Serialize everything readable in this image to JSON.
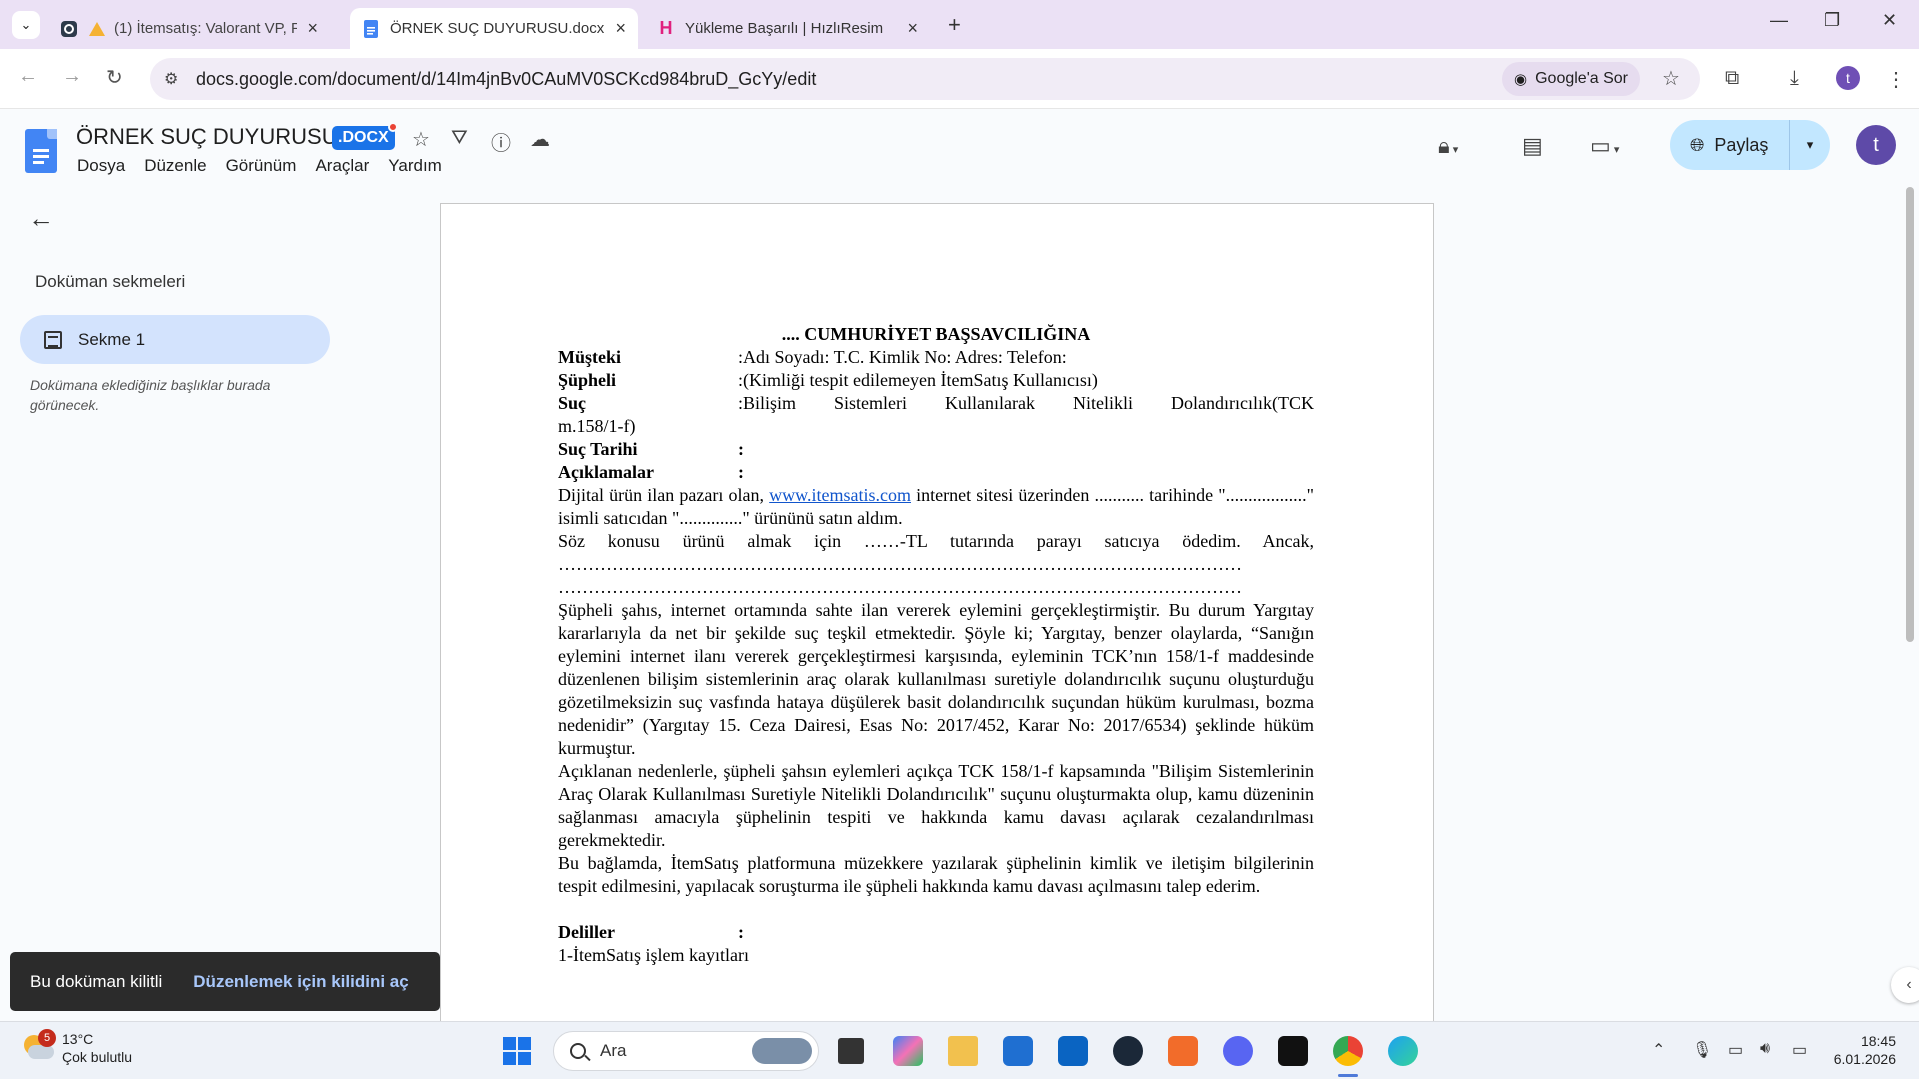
{
  "browser": {
    "tabs": [
      {
        "title": "(1) İtemsatış: Valorant VP, P",
        "active": false
      },
      {
        "title": "ÖRNEK SUÇ DUYURUSU.docx -",
        "active": true
      },
      {
        "title": "Yükleme Başarılı | HızlıResim",
        "active": false
      }
    ],
    "url": "docs.google.com/document/d/14Im4jnBv0CAuMV0SCKcd984bruD_GcYy/edit",
    "ask_google": "Google'a Sor",
    "profile_letter": "t"
  },
  "docs": {
    "title": "ÖRNEK SUÇ DUYURUSU",
    "badge": ".DOCX",
    "menu": [
      "Dosya",
      "Düzenle",
      "Görünüm",
      "Araçlar",
      "Yardım"
    ],
    "share_label": "Paylaş",
    "avatar_letter": "t"
  },
  "sidebar": {
    "heading": "Doküman sekmeleri",
    "tab_label": "Sekme 1",
    "note": "Dokümana eklediğiniz başlıklar burada görünecek."
  },
  "toast": {
    "message": "Bu doküman kilitli",
    "action": "Düzenlemek için kilidini aç"
  },
  "document": {
    "heading": ".... CUMHURİYET BAŞSAVCILIĞINA",
    "fields": [
      {
        "key": "Müşteki",
        "value": ":Adı Soyadı: T.C. Kimlik No: Adres: Telefon:"
      },
      {
        "key": "Şüpheli",
        "value": ":(Kimliği tespit edilemeyen İtemSatış Kullanıcısı)"
      },
      {
        "key": "Suç",
        "value": ":Bilişim Sistemleri Kullanılarak Nitelikli Dolandırıcılık(TCK"
      }
    ],
    "suc_cont": "m.158/1-f)",
    "fields2": [
      {
        "key": "Suç Tarihi",
        "value": ":"
      },
      {
        "key": "Açıklamalar",
        "value": ":"
      }
    ],
    "p1_before": "Dijital ürün ilan pazarı olan, ",
    "p1_link": "www.itemsatis.com",
    "p1_after": " internet sitesi üzerinden ........... tarihinde \"..................\" isimli satıcıdan \"..............\" ürününü satın aldım.",
    "p2": "Söz konusu ürünü almak için ……-TL tutarında parayı satıcıya ödedim. Ancak,",
    "dots1": "……………………………………………………………………………………………………",
    "dots2": "……………………………………………………………………………………………………",
    "p3": "Şüpheli şahıs, internet ortamında sahte ilan vererek eylemini gerçekleştirmiştir. Bu durum Yargıtay kararlarıyla da net bir şekilde suç teşkil etmektedir. Şöyle ki; Yargıtay, benzer olaylarda, “Sanığın eylemini internet ilanı vererek gerçekleştirmesi karşısında, eyleminin TCK’nın 158/1-f maddesinde düzenlenen bilişim sistemlerinin araç olarak kullanılması suretiyle dolandırıcılık suçunu oluşturduğu gözetilmeksizin suç vasfında hataya düşülerek basit dolandırıcılık suçundan hüküm kurulması, bozma nedenidir” (Yargıtay 15. Ceza Dairesi, Esas No: 2017/452, Karar No: 2017/6534) şeklinde hüküm kurmuştur.",
    "p4": "Açıklanan nedenlerle, şüpheli şahsın eylemleri açıkça TCK 158/1-f kapsamında \"Bilişim Sistemlerinin Araç Olarak Kullanılması Suretiyle Nitelikli Dolandırıcılık\" suçunu oluşturmakta olup, kamu düzeninin sağlanması amacıyla şüphelinin tespiti ve hakkında kamu davası açılarak cezalandırılması gerekmektedir.",
    "p5": "Bu bağlamda, İtemSatış platformuna müzekkere yazılarak şüphelinin kimlik ve iletişim bilgilerinin tespit edilmesini, yapılacak soruşturma ile şüpheli hakkında kamu davası açılmasını talep ederim.",
    "evidence_key": "Deliller",
    "evidence_value": ":",
    "evidence_1": "1-İtemSatış işlem kayıtları"
  },
  "taskbar": {
    "temp": "13°C",
    "weather": "Çok bulutlu",
    "weather_badge": "5",
    "search_label": "Ara",
    "time": "18:45",
    "date": "6.01.2026"
  },
  "colors": {
    "tabstrip": "#ebe1f5",
    "share": "#c2e7ff",
    "sidebar_active": "#d3e3fd",
    "docs_blue": "#4285f4"
  }
}
